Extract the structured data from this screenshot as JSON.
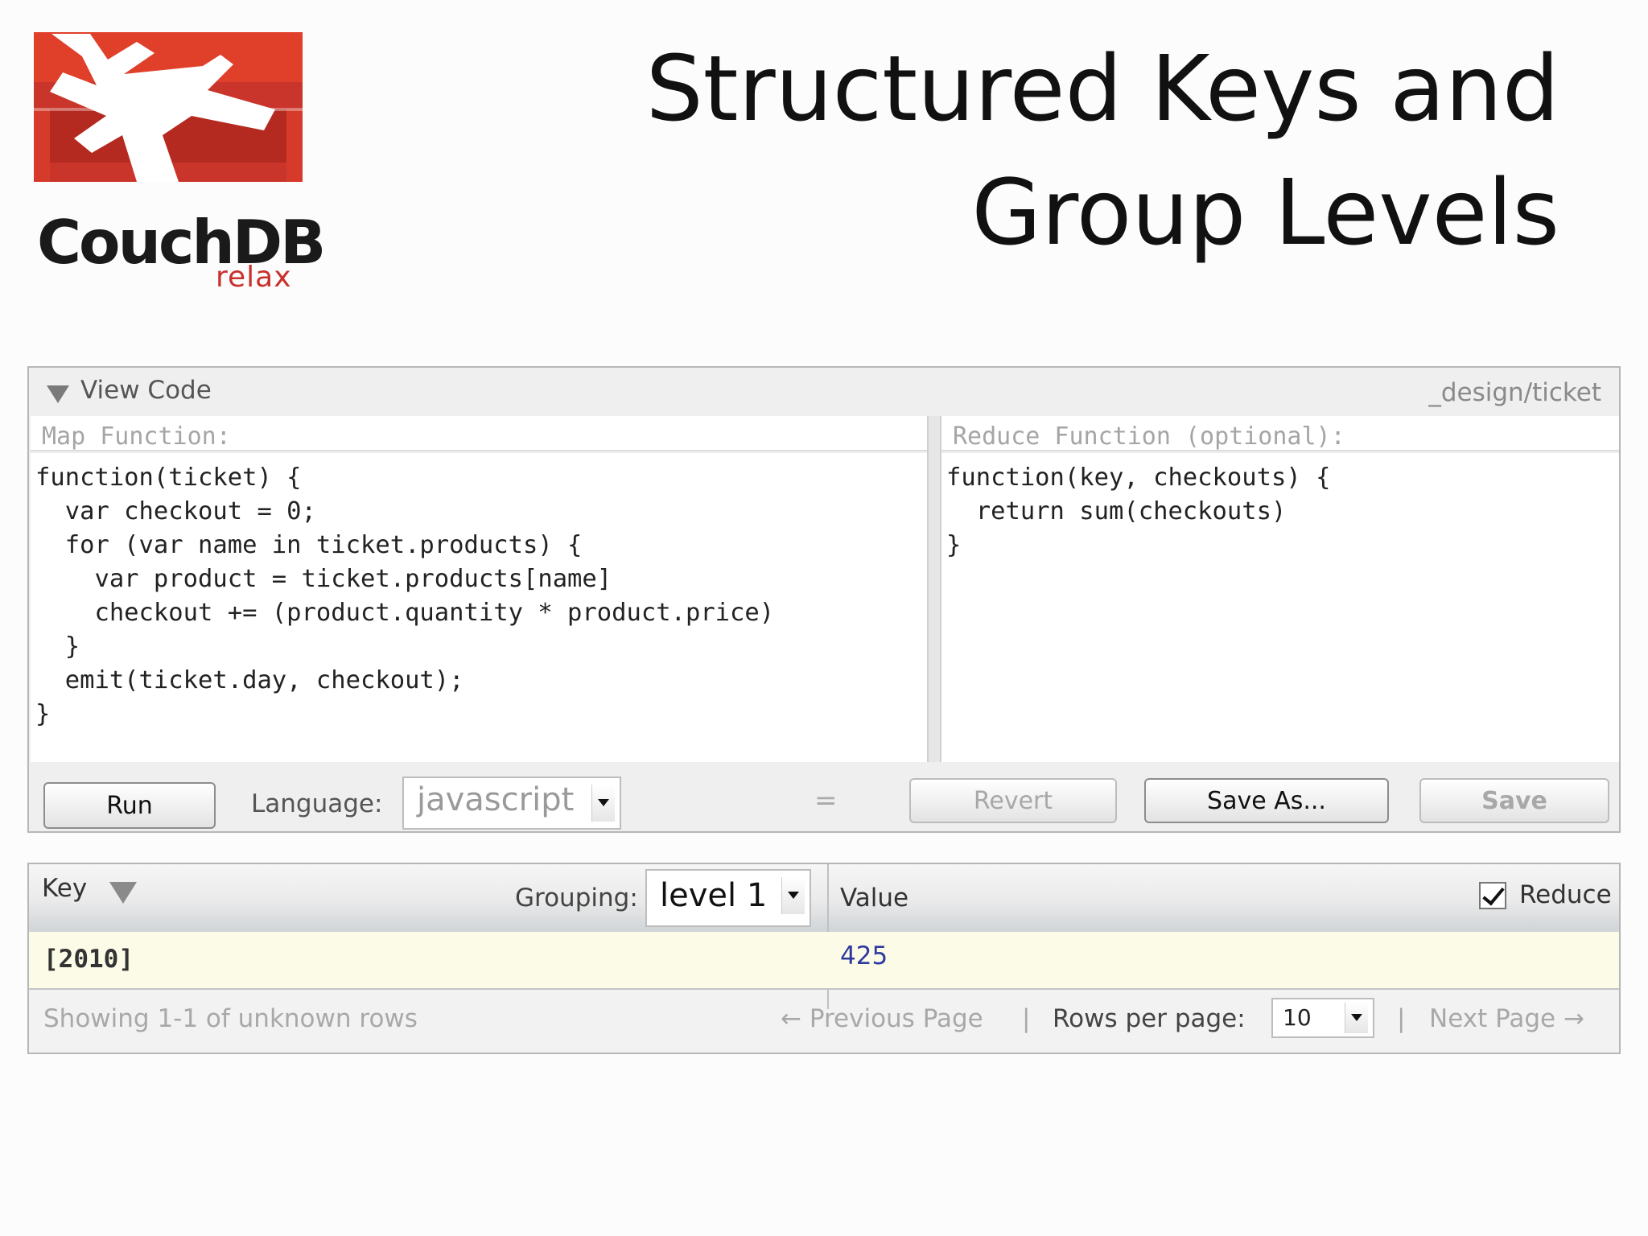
{
  "logo": {
    "name": "CouchDB",
    "tagline": "relax"
  },
  "slide": {
    "title_line1": "Structured Keys and",
    "title_line2": "Group Levels"
  },
  "view_panel": {
    "title": "View Code",
    "design_doc": "_design/ticket",
    "map_label": "Map Function:",
    "reduce_label": "Reduce Function (optional):",
    "map_code": "function(ticket) {\n  var checkout = 0;\n  for (var name in ticket.products) {\n    var product = ticket.products[name]\n    checkout += (product.quantity * product.price)\n  }\n  emit(ticket.day, checkout);\n}",
    "reduce_code": "function(key, checkouts) {\n  return sum(checkouts)\n}",
    "run_label": "Run",
    "language_label": "Language:",
    "language_value": "javascript",
    "equals": "=",
    "revert_label": "Revert",
    "save_as_label": "Save As...",
    "save_label": "Save"
  },
  "results": {
    "key_header": "Key",
    "grouping_label": "Grouping:",
    "grouping_value": "level 1",
    "value_header": "Value",
    "reduce_checkbox_label": "Reduce",
    "reduce_checked": true,
    "rows": [
      {
        "key": "[2010]",
        "value": "425"
      }
    ],
    "showing": "Showing 1-1 of unknown rows",
    "prev_page": "← Previous Page",
    "separator": "|",
    "rows_per_page_label": "Rows per page:",
    "rows_per_page_value": "10",
    "next_page": "Next Page →"
  },
  "colors": {
    "logo_red": "#e03f2a",
    "logo_dark_red": "#b52a20",
    "value_blue": "#2e3a9e",
    "row_highlight": "#fcfbe8"
  }
}
